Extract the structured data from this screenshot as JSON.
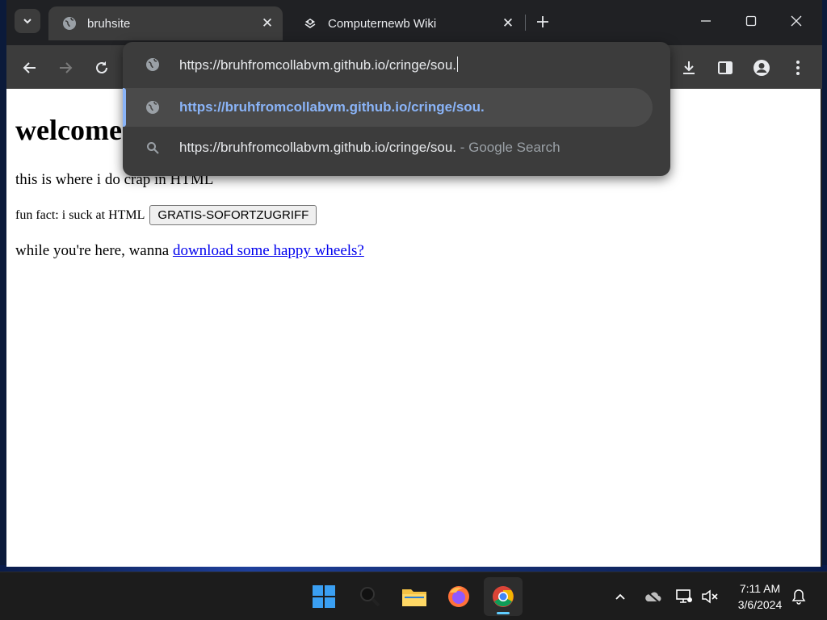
{
  "browser": {
    "tabs": [
      {
        "title": "bruhsite",
        "favicon": "globe-icon",
        "active": true
      },
      {
        "title": "Computernewb Wiki",
        "favicon": "wiki-puzzle-icon",
        "active": false
      }
    ],
    "omnibox": {
      "text": "https://bruhfromcollabvm.github.io/cringe/sou.",
      "suggestions": [
        {
          "icon": "globe-icon",
          "text": "https://bruhfromcollabvm.github.io/cringe/sou.",
          "suffix": "",
          "selected": true
        },
        {
          "icon": "search-icon",
          "text": "https://bruhfromcollabvm.github.io/cringe/sou.",
          "suffix": " - Google Search",
          "selected": false
        }
      ]
    }
  },
  "page": {
    "heading": "welcome",
    "line1": "this is where i do crap in HTML",
    "fun_fact": "fun fact: i suck at HTML",
    "button_label": "GRATIS-SOFORTZUGRIFF",
    "line3_prefix": "while you're here, wanna ",
    "link_text": "download some happy wheels?"
  },
  "taskbar": {
    "time": "7:11 AM",
    "date": "3/6/2024"
  },
  "colors": {
    "accent": "#8ab4f8",
    "link": "#0000ee",
    "taskbar_indicator": "#60cdff"
  }
}
